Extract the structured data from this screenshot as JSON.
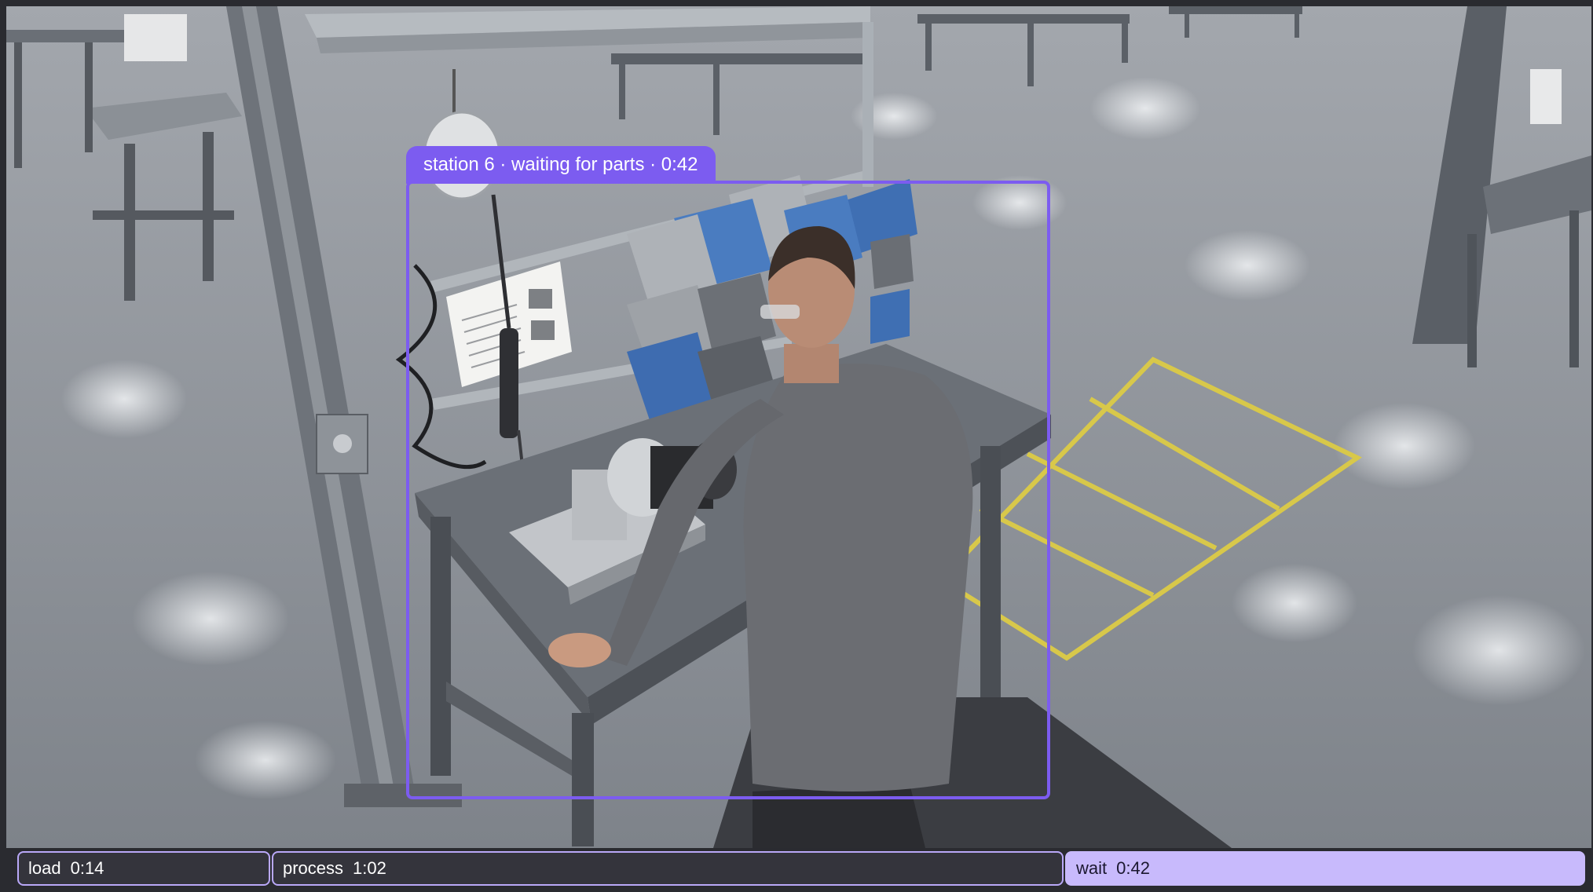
{
  "detection": {
    "label": "station 6 · waiting for parts · 0:42"
  },
  "timeline": {
    "segments": [
      {
        "label": "load",
        "time": "0:14",
        "state": "inactive"
      },
      {
        "label": "process",
        "time": "1:02",
        "state": "inactive"
      },
      {
        "label": "wait",
        "time": "0:42",
        "state": "active"
      }
    ]
  },
  "colors": {
    "accent": "#7c5cf0",
    "active_segment": "#c8bafc",
    "segment_border": "#b9a8f8",
    "background": "#2a2b30",
    "floor_marking": "#d8c84a"
  }
}
